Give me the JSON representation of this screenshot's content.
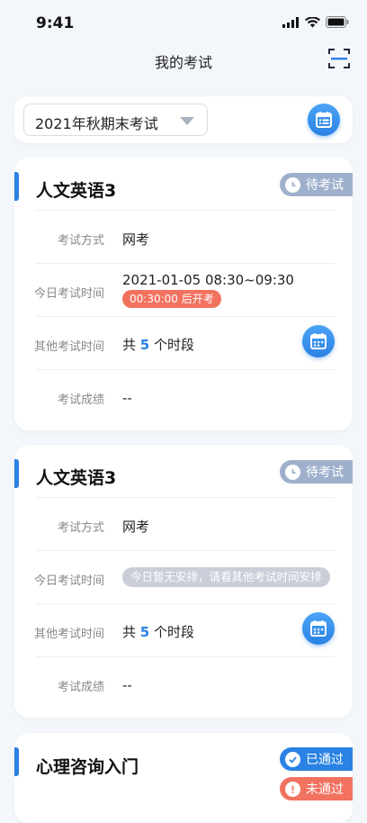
{
  "status_bar": {
    "time": "9:41"
  },
  "header": {
    "title": "我的考试"
  },
  "selector": {
    "value": "2021年秋期末考试"
  },
  "labels": {
    "method": "考试方式",
    "today_time": "今日考试时间",
    "other_time": "其他考试时间",
    "score": "考试成绩"
  },
  "cards": [
    {
      "title": "人文英语3",
      "status": "待考试",
      "method": "网考",
      "today_time": "2021-01-05 08:30~09:30",
      "countdown": "00:30:00 后开考",
      "other_prefix": "共",
      "other_count": "5",
      "other_suffix": "个时段",
      "score": "--"
    },
    {
      "title": "人文英语3",
      "status": "待考试",
      "method": "网考",
      "today_none": "今日暂无安排，请看其他考试时间安排",
      "other_prefix": "共",
      "other_count": "5",
      "other_suffix": "个时段",
      "score": "--"
    },
    {
      "title": "心理咨询入门",
      "status_passed": "已通过",
      "status_failed": "未通过"
    }
  ],
  "colors": {
    "accent": "#2a82e4",
    "pending": "#9fb0cc",
    "alert": "#f27260"
  }
}
